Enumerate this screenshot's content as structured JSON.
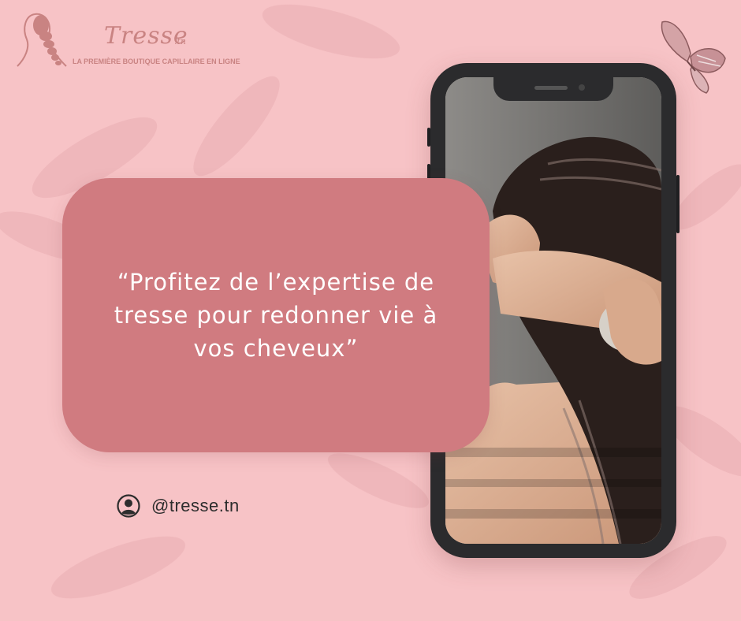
{
  "brand": {
    "name": "Tresse",
    "suffix": ".tn",
    "tagline": "LA PREMIÈRE BOUTIQUE CAPILLAIRE EN LIGNE",
    "logo_icon": "braid-silhouette-icon"
  },
  "decoration": {
    "butterfly_icon": "butterfly-icon",
    "phone_image": "wet-hair-photo"
  },
  "quote": {
    "text": "“Profitez de l’expertise de tresse pour redonner vie à vos cheveux”"
  },
  "social": {
    "icon": "user-circle-icon",
    "handle": "@tresse.tn"
  },
  "colors": {
    "background": "#f7c3c6",
    "card": "#d07b80",
    "brand": "#c98382",
    "phone_frame": "#2b2b2d"
  }
}
